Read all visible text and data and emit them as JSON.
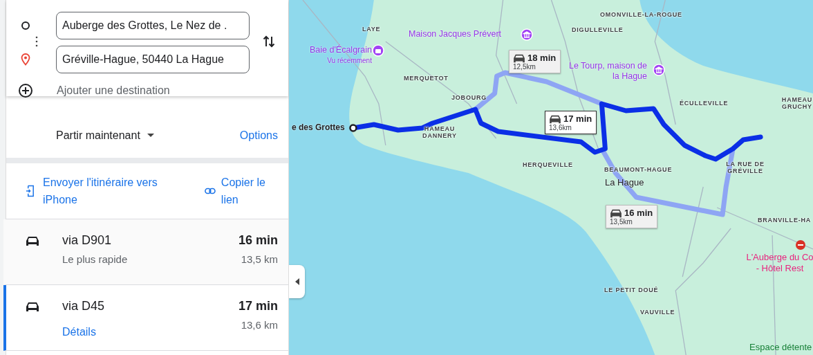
{
  "directions": {
    "origin": {
      "value": "Auberge des Grottes, Le Nez de ."
    },
    "destination": {
      "value": "Gréville-Hague, 50440 La Hague"
    },
    "add_stop": {
      "label": "Ajouter une destination"
    }
  },
  "depart": {
    "label": "Partir maintenant",
    "options": "Options"
  },
  "share": {
    "send": "Envoyer l'itinéraire vers iPhone",
    "copy": "Copier le lien"
  },
  "routes": [
    {
      "name": "via D901",
      "note": "Le plus rapide",
      "time": "16 min",
      "distance": "13,5 km",
      "selected": false
    },
    {
      "name": "via D45",
      "link": "Détails",
      "time": "17 min",
      "distance": "13,6 km",
      "selected": true
    }
  ],
  "map": {
    "labels": [
      {
        "kind": "start",
        "text": "e des Grottes"
      },
      {
        "kind": "village",
        "text": "LAYE"
      },
      {
        "kind": "poi",
        "text": "Maison Jacques Prévert"
      },
      {
        "kind": "poi",
        "text": "Baie d'Écalgrain",
        "sub": "Vu récemment"
      },
      {
        "kind": "village",
        "text": "MERQUETOT"
      },
      {
        "kind": "village",
        "text": "JOBOURG"
      },
      {
        "kind": "village",
        "text": "HAMEAU DANNERY"
      },
      {
        "kind": "village",
        "text": "HERQUEVILLE"
      },
      {
        "kind": "village",
        "text": "OMONVILLE-LA-ROGUE"
      },
      {
        "kind": "village",
        "text": "DIGULLEVILLE"
      },
      {
        "kind": "poi",
        "text": "Le Tourp, maison de la Hague"
      },
      {
        "kind": "village",
        "text": "ÉCULLEVILLE"
      },
      {
        "kind": "village",
        "text": "HAMEAU GRUCHY"
      },
      {
        "kind": "village",
        "text": "BEAUMONT-HAGUE"
      },
      {
        "kind": "village",
        "text": "LA RUE DE GRÉVILLE"
      },
      {
        "kind": "town",
        "text": "La Hague"
      },
      {
        "kind": "village",
        "text": "BRANVILLE-HA"
      },
      {
        "kind": "hotel",
        "text": "L'Auberge du Co - Hôtel Rest"
      },
      {
        "kind": "village",
        "text": "LE PETIT DOUÉ"
      },
      {
        "kind": "village",
        "text": "VAUVILLE"
      },
      {
        "kind": "park",
        "text": "Espace détente"
      }
    ],
    "route_bubbles": [
      {
        "time": "18 min",
        "distance": "12,5km",
        "selected": false
      },
      {
        "time": "17 min",
        "distance": "13,6km",
        "selected": true
      },
      {
        "time": "16 min",
        "distance": "13,5km",
        "selected": false
      }
    ]
  }
}
